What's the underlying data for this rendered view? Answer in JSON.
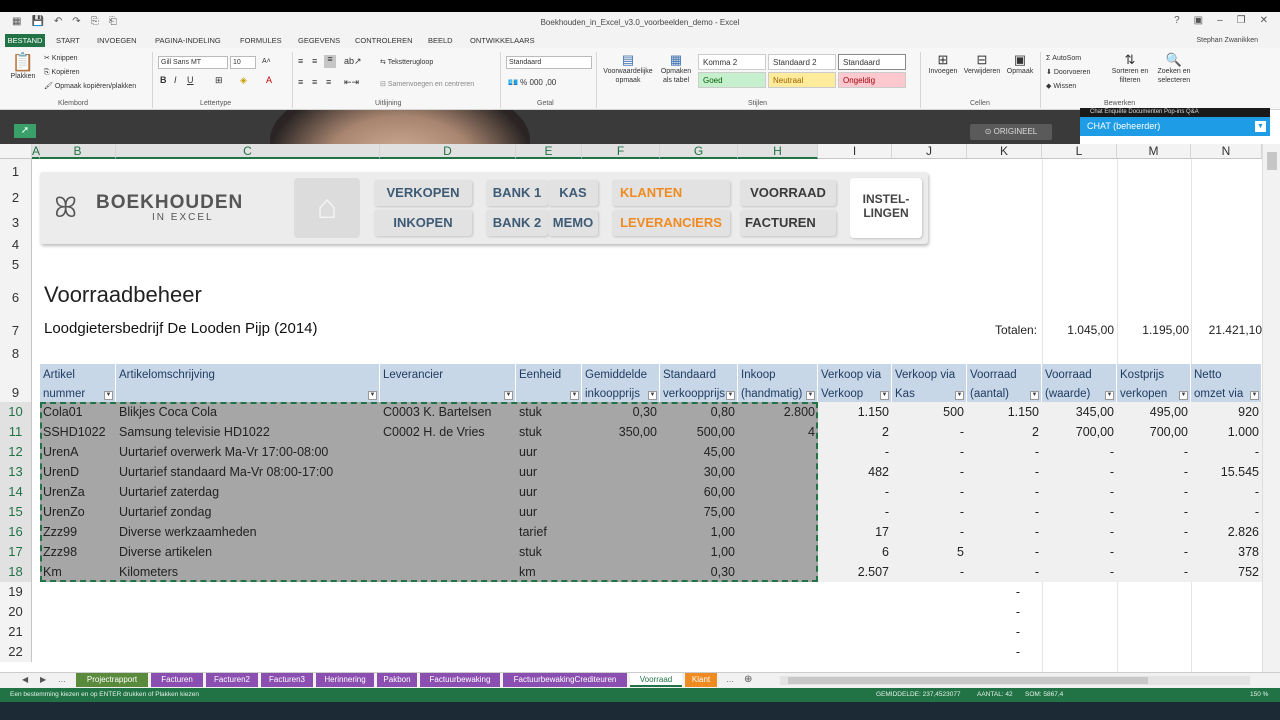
{
  "window": {
    "title": "Boekhouden_in_Excel_v3.0_voorbeelden_demo - Excel",
    "user": "Stephan Zwanikken"
  },
  "ribbon_tabs": [
    "BESTAND",
    "START",
    "INVOEGEN",
    "PAGINA-INDELING",
    "FORMULES",
    "GEGEVENS",
    "CONTROLEREN",
    "BEELD",
    "ONTWIKKELAARS"
  ],
  "ribbon": {
    "clipboard": {
      "paste": "Plakken",
      "cut": "Knippen",
      "copy": "Kopiëren",
      "painter": "Opmaak kopiëren/plakken",
      "label": "Klembord"
    },
    "font": {
      "name": "Gill Sans MT",
      "size": "10",
      "label": "Lettertype"
    },
    "alignment": {
      "wrap": "Tekstterugloop",
      "merge": "Samenvoegen en centreren",
      "label": "Uitlijning"
    },
    "number": {
      "format": "Standaard",
      "label": "Getal"
    },
    "styles": {
      "cond": "Voorwaardelijke opmaak",
      "table": "Opmaken als tabel",
      "komma2": "Komma 2",
      "std2": "Standaard 2",
      "std": "Standaard",
      "goed": "Goed",
      "neutraal": "Neutraal",
      "ongeldig": "Ongeldig",
      "label": "Stijlen"
    },
    "cells": {
      "insert": "Invoegen",
      "delete": "Verwijderen",
      "format": "Opmaak",
      "label": "Cellen"
    },
    "editing": {
      "autosum": "AutoSom",
      "fill": "Doorvoeren",
      "clear": "Wissen",
      "sort": "Sorteren en filteren",
      "find": "Zoeken en selecteren",
      "label": "Bewerken"
    }
  },
  "overlay": {
    "origin_label": "ORIGINEEL",
    "chat_label": "CHAT (beheerder)",
    "chat_tabs": "Chat   Enquête   Documenten   Pop-ins   Q&A"
  },
  "columns": [
    "A",
    "B",
    "C",
    "D",
    "E",
    "F",
    "G",
    "H",
    "I",
    "J",
    "K",
    "L",
    "M",
    "N"
  ],
  "row_numbers": [
    "1",
    "2",
    "3",
    "4",
    "5",
    "6",
    "7",
    "8",
    "9",
    "10",
    "11",
    "12",
    "13",
    "14",
    "15",
    "16",
    "17",
    "18",
    "19",
    "20",
    "21",
    "22"
  ],
  "nav": {
    "logo_main": "BOEKHOUDEN",
    "logo_sub": "IN EXCEL",
    "verkopen": "VERKOPEN",
    "inkopen": "INKOPEN",
    "bank1": "BANK 1",
    "kas": "KAS",
    "bank2": "BANK 2",
    "memo": "MEMO",
    "klanten": "KLANTEN",
    "leveranciers": "LEVERANCIERS",
    "voorraad": "VOORRAAD",
    "facturen": "FACTUREN",
    "instellingen1": "INSTEL-",
    "instellingen2": "LINGEN"
  },
  "page": {
    "title": "Voorraadbeheer",
    "company": "Loodgietersbedrijf De Looden Pijp (2014)",
    "totals_label": "Totalen:",
    "totals": [
      "1.045,00",
      "1.195,00",
      "21.421,10"
    ]
  },
  "table_headers": {
    "b": [
      "Artikel",
      "nummer"
    ],
    "c": [
      "Artikelomschrijving",
      ""
    ],
    "d": [
      "Leverancier",
      ""
    ],
    "e": [
      "Eenheid",
      ""
    ],
    "f": [
      "Gemiddelde",
      "inkoopprijs"
    ],
    "g": [
      "Standaard",
      "verkoopprijs"
    ],
    "h": [
      "Inkoop",
      "(handmatig)"
    ],
    "i": [
      "Verkoop via",
      "Verkoop"
    ],
    "j": [
      "Verkoop via",
      "Kas"
    ],
    "k": [
      "Voorraad",
      "(aantal)"
    ],
    "l": [
      "Voorraad",
      "(waarde)"
    ],
    "m": [
      "Kostprijs",
      "verkopen"
    ],
    "n": [
      "Netto",
      "omzet via"
    ]
  },
  "rows": [
    {
      "b": "Cola01",
      "c": "Blikjes Coca Cola",
      "d": "C0003 K. Bartelsen",
      "e": "stuk",
      "f": "0,30",
      "g": "0,80",
      "h": "2.800",
      "i": "1.150",
      "j": "500",
      "k": "1.150",
      "l": "345,00",
      "m": "495,00",
      "n": "920"
    },
    {
      "b": "SSHD1022",
      "c": "Samsung televisie HD1022",
      "d": "C0002 H. de Vries",
      "e": "stuk",
      "f": "350,00",
      "g": "500,00",
      "h": "4",
      "i": "2",
      "j": "-",
      "k": "2",
      "l": "700,00",
      "m": "700,00",
      "n": "1.000"
    },
    {
      "b": "UrenA",
      "c": "Uurtarief overwerk Ma-Vr 17:00-08:00",
      "d": "",
      "e": "uur",
      "f": "",
      "g": "45,00",
      "h": "",
      "i": "-",
      "j": "-",
      "k": "-",
      "l": "-",
      "m": "-",
      "n": "-"
    },
    {
      "b": "UrenD",
      "c": "Uurtarief standaard Ma-Vr 08:00-17:00",
      "d": "",
      "e": "uur",
      "f": "",
      "g": "30,00",
      "h": "",
      "i": "482",
      "j": "-",
      "k": "-",
      "l": "-",
      "m": "-",
      "n": "15.545"
    },
    {
      "b": "UrenZa",
      "c": "Uurtarief zaterdag",
      "d": "",
      "e": "uur",
      "f": "",
      "g": "60,00",
      "h": "",
      "i": "-",
      "j": "-",
      "k": "-",
      "l": "-",
      "m": "-",
      "n": "-"
    },
    {
      "b": "UrenZo",
      "c": "Uurtarief zondag",
      "d": "",
      "e": "uur",
      "f": "",
      "g": "75,00",
      "h": "",
      "i": "-",
      "j": "-",
      "k": "-",
      "l": "-",
      "m": "-",
      "n": "-"
    },
    {
      "b": "Zzz99",
      "c": "Diverse werkzaamheden",
      "d": "",
      "e": "tarief",
      "f": "",
      "g": "1,00",
      "h": "",
      "i": "17",
      "j": "-",
      "k": "-",
      "l": "-",
      "m": "-",
      "n": "2.826"
    },
    {
      "b": "Zzz98",
      "c": "Diverse artikelen",
      "d": "",
      "e": "stuk",
      "f": "",
      "g": "1,00",
      "h": "",
      "i": "6",
      "j": "5",
      "k": "-",
      "l": "-",
      "m": "-",
      "n": "378"
    },
    {
      "b": "Km",
      "c": "Kilometers",
      "d": "",
      "e": "km",
      "f": "",
      "g": "0,30",
      "h": "",
      "i": "2.507",
      "j": "-",
      "k": "-",
      "l": "-",
      "m": "-",
      "n": "752"
    }
  ],
  "extra_k": [
    "-",
    "-",
    "-",
    "-"
  ],
  "sheet_tabs": [
    {
      "label": "Projectrapport",
      "color": "#5a8a3c"
    },
    {
      "label": "Facturen",
      "color": "#8a4fb0"
    },
    {
      "label": "Facturen2",
      "color": "#8a4fb0"
    },
    {
      "label": "Facturen3",
      "color": "#8a4fb0"
    },
    {
      "label": "Herinnering",
      "color": "#8a4fb0"
    },
    {
      "label": "Pakbon",
      "color": "#8a4fb0"
    },
    {
      "label": "Factuurbewaking",
      "color": "#8a4fb0"
    },
    {
      "label": "FactuurbewakingCrediteuren",
      "color": "#8a4fb0"
    },
    {
      "label": "Voorraad",
      "color": "#ffffff"
    },
    {
      "label": "Klant",
      "color": "#f08b21"
    }
  ],
  "status": {
    "message": "Een bestemming kiezen en op ENTER drukken of Plakken kiezen",
    "avg": "GEMIDDELDE: 237,4523077",
    "count": "AANTAL: 42",
    "sum": "SOM: 5867,4",
    "zoom": "150 %"
  }
}
